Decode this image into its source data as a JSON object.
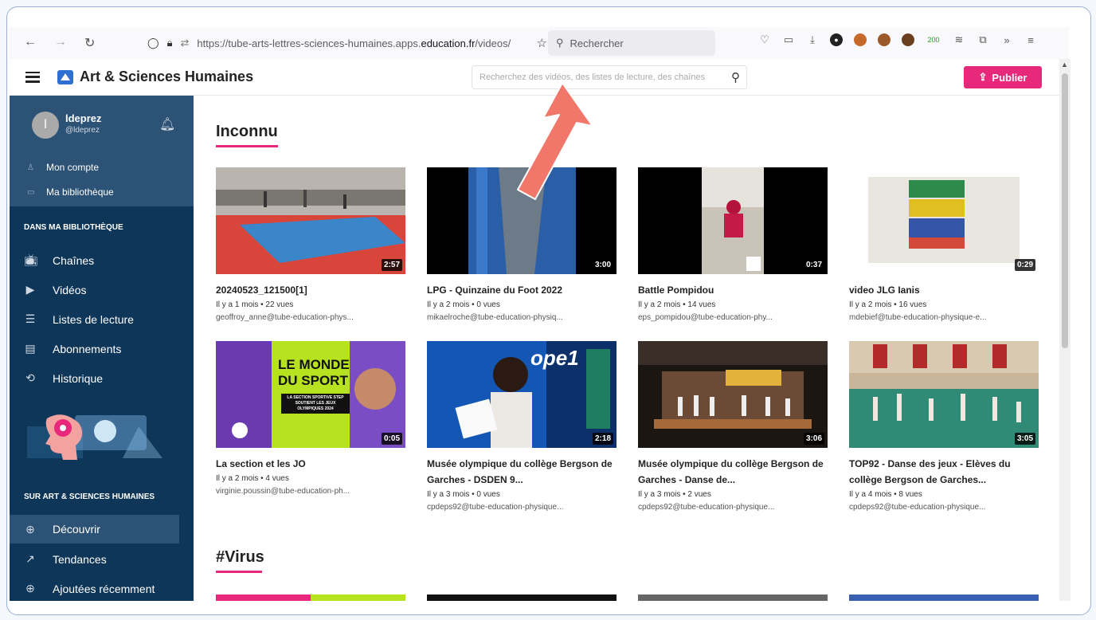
{
  "browser": {
    "url_prefix": "https://tube-arts-lettres-sciences-humaines.apps.",
    "url_domain": "education.fr",
    "url_suffix": "/videos/",
    "search_placeholder": "Rechercher",
    "ext_count": "200"
  },
  "app": {
    "title": "Art & Sciences Humaines",
    "search_placeholder": "Recherchez des vidéos, des listes de lecture, des chaînes",
    "publish_label": "Publier"
  },
  "user": {
    "initial": "l",
    "name": "ldeprez",
    "handle": "@ldeprez",
    "account": "Mon compte",
    "library": "Ma bibliothèque"
  },
  "sidebar": {
    "library_heading": "DANS MA BIBLIOTHÈQUE",
    "library_items": [
      {
        "label": "Chaînes",
        "icon": "tv-icon"
      },
      {
        "label": "Vidéos",
        "icon": "video-icon"
      },
      {
        "label": "Listes de lecture",
        "icon": "list-icon"
      },
      {
        "label": "Abonnements",
        "icon": "subscriptions-icon"
      },
      {
        "label": "Historique",
        "icon": "history-icon"
      }
    ],
    "site_heading": "SUR ART & SCIENCES HUMAINES",
    "site_items": [
      {
        "label": "Découvrir",
        "icon": "globe-icon"
      },
      {
        "label": "Tendances",
        "icon": "trending-icon"
      },
      {
        "label": "Ajoutées récemment",
        "icon": "plus-circle-icon"
      }
    ]
  },
  "sections": [
    {
      "title": "Inconnu"
    },
    {
      "title": "#Virus"
    }
  ],
  "videos": [
    {
      "title": "20240523_121500[1]",
      "meta": "Il y a 1 mois • 22 vues",
      "owner": "geoffroy_anne@tube-education-phys...",
      "duration": "2:57"
    },
    {
      "title": "LPG - Quinzaine du Foot 2022",
      "meta": "Il y a 2 mois • 0 vues",
      "owner": "mikaelroche@tube-education-physiq...",
      "duration": "3:00"
    },
    {
      "title": "Battle Pompidou",
      "meta": "Il y a 2 mois • 14 vues",
      "owner": "eps_pompidou@tube-education-phy...",
      "duration": "0:37"
    },
    {
      "title": "video JLG Ianis",
      "meta": "Il y a 2 mois • 16 vues",
      "owner": "mdebief@tube-education-physique-e...",
      "duration": "0:29"
    },
    {
      "title": "La section et les JO",
      "meta": "Il y a 2 mois • 4 vues",
      "owner": "virginie.poussin@tube-education-ph...",
      "duration": "0:05"
    },
    {
      "title": "Musée olympique du collège Bergson de Garches - DSDEN 9...",
      "meta": "Il y a 3 mois • 0 vues",
      "owner": "cpdeps92@tube-education-physique...",
      "duration": "2:18"
    },
    {
      "title": "Musée olympique du collège Bergson de Garches - Danse de...",
      "meta": "Il y a 3 mois • 2 vues",
      "owner": "cpdeps92@tube-education-physique...",
      "duration": "3:06"
    },
    {
      "title": "TOP92 - Danse des jeux - Elèves du collège Bergson de Garches...",
      "meta": "Il y a 4 mois • 8 vues",
      "owner": "cpdeps92@tube-education-physique...",
      "duration": "3:05"
    }
  ],
  "thumb_text": {
    "sport_line1": "LE MONDE",
    "sport_line2": "DU SPORT",
    "sport_sub": "LA SECTION SPORTIVE STEP SOUTIENT LES JEUX OLYMPIQUES 2024",
    "radio": "ope1"
  },
  "colors": {
    "accent": "#e8287b",
    "sidebar": "#0e3658",
    "arrow": "#f0776a"
  }
}
